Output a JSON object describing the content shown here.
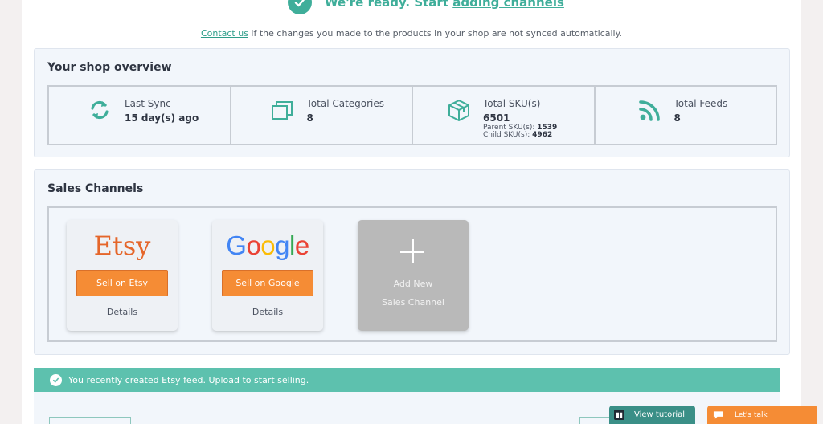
{
  "header": {
    "ready_text": "We're ready. Start",
    "ready_link": "adding channels",
    "contact_link": "Contact us",
    "contact_rest": " if the changes you made to the products in your shop are not synced automatically."
  },
  "overview": {
    "title": "Your shop overview",
    "last_sync": {
      "label": "Last Sync",
      "value": "15 day(s) ago",
      "icon": "sync-icon"
    },
    "categories": {
      "label": "Total Categories",
      "value": "8",
      "icon": "categories-icon"
    },
    "skus": {
      "label": "Total SKU(s)",
      "value": "6501",
      "icon": "package-icon",
      "parent_label": "Parent SKU(s):",
      "parent_value": "1539",
      "child_label": "Child SKU(s):",
      "child_value": "4962"
    },
    "feeds": {
      "label": "Total Feeds",
      "value": "8",
      "icon": "rss-icon"
    }
  },
  "channels": {
    "title": "Sales Channels",
    "items": [
      {
        "logo": "Etsy",
        "button": "Sell on Etsy",
        "details": "Details"
      },
      {
        "logo": "Google",
        "button": "Sell on Google",
        "details": "Details"
      }
    ],
    "add_new_line1": "Add New",
    "add_new_line2": "Sales Channel"
  },
  "notice": {
    "text": "You recently created Etsy feed. Upload to start selling."
  },
  "widgets": {
    "tutorial": "View tutorial",
    "talk": "Let's talk"
  },
  "colors": {
    "accent": "#3fae9a",
    "orange": "#f58c35",
    "etsy": "#e5662a",
    "notice": "#5dc1ae"
  }
}
